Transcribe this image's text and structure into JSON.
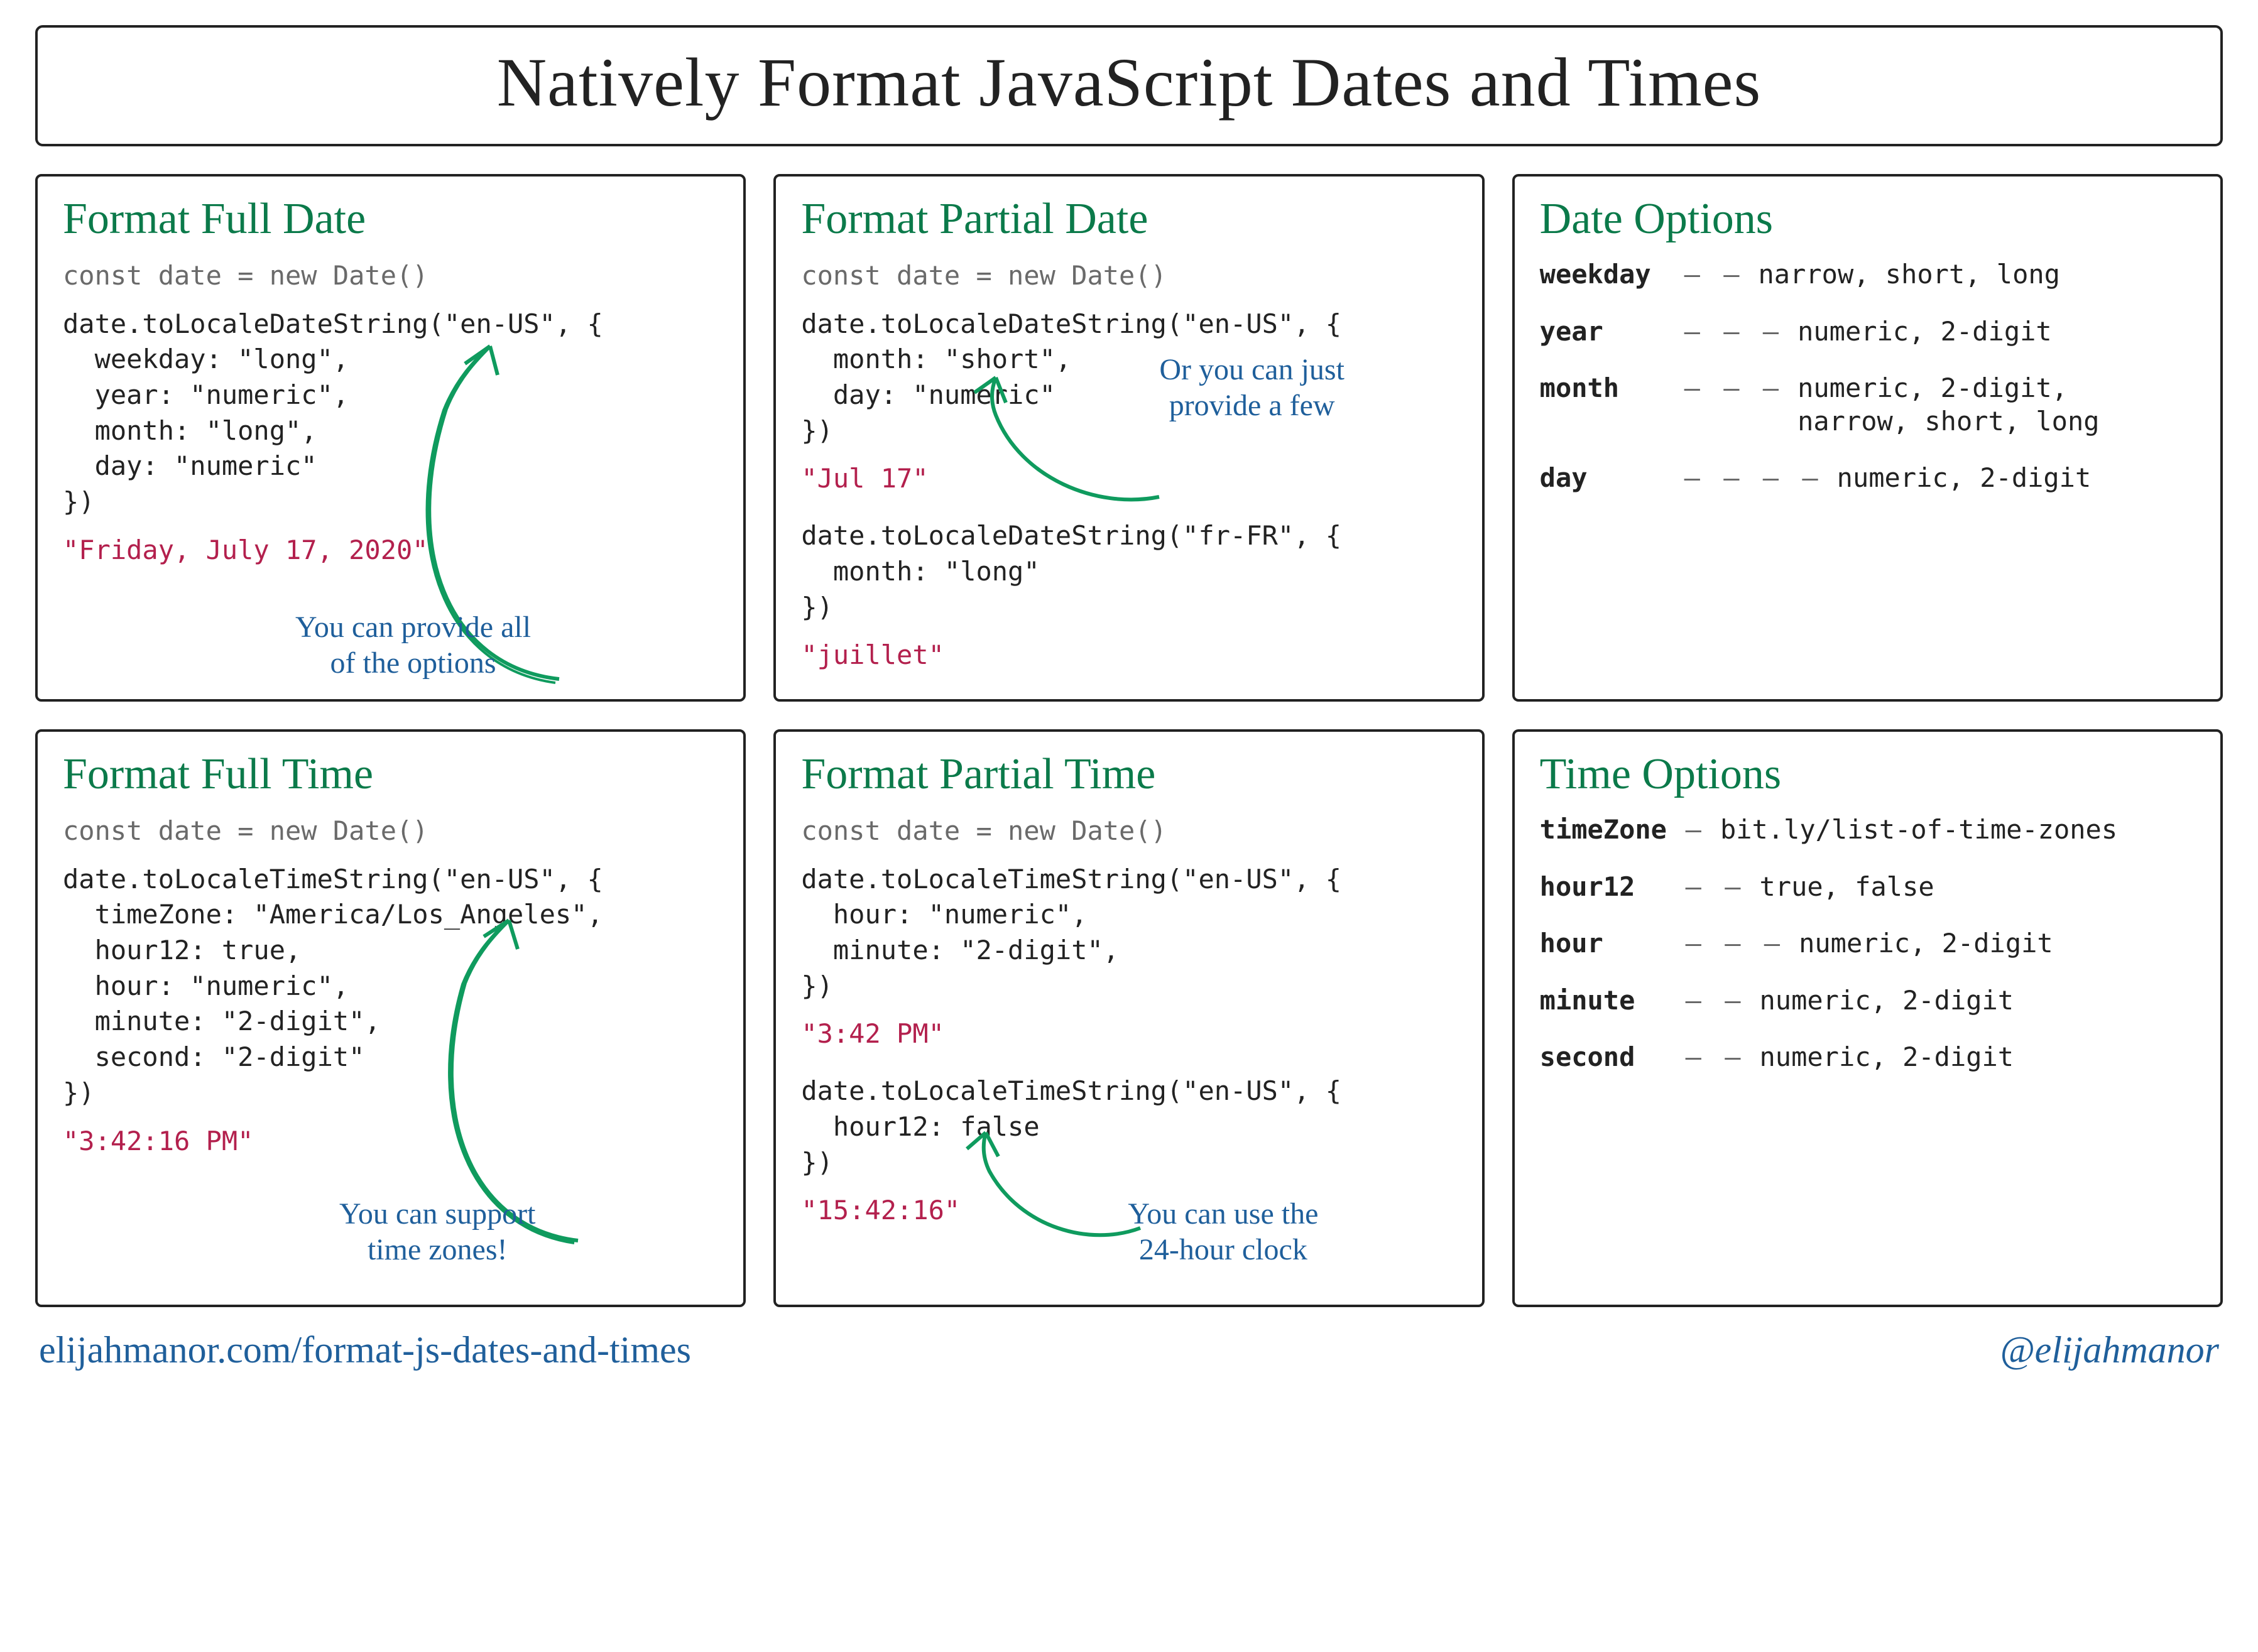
{
  "title": "Natively Format JavaScript Dates and Times",
  "panels": {
    "full_date": {
      "heading": "Format Full Date",
      "decl": "const date = new Date()",
      "code": "date.toLocaleDateString(\"en-US\", {\n  weekday: \"long\",\n  year: \"numeric\",\n  month: \"long\",\n  day: \"numeric\"\n})",
      "result": "\"Friday, July 17, 2020\"",
      "annot": "You can provide all\nof the options"
    },
    "partial_date": {
      "heading": "Format Partial Date",
      "decl": "const date = new Date()",
      "code1": "date.toLocaleDateString(\"en-US\", {\n  month: \"short\",\n  day: \"numeric\"\n})",
      "result1": "\"Jul 17\"",
      "code2": "date.toLocaleDateString(\"fr-FR\", {\n  month: \"long\"\n})",
      "result2": "\"juillet\"",
      "annot": "Or you can just\nprovide a few"
    },
    "date_options": {
      "heading": "Date Options",
      "rows": [
        {
          "key": "weekday",
          "dashes": "— —",
          "vals": "narrow, short, long"
        },
        {
          "key": "year",
          "dashes": "— — —",
          "vals": "numeric, 2-digit"
        },
        {
          "key": "month",
          "dashes": "— — —",
          "vals": "numeric, 2-digit,\nnarrow, short, long"
        },
        {
          "key": "day",
          "dashes": "— — — —",
          "vals": "numeric, 2-digit"
        }
      ]
    },
    "full_time": {
      "heading": "Format Full Time",
      "decl": "const date = new Date()",
      "code": "date.toLocaleTimeString(\"en-US\", {\n  timeZone: \"America/Los_Angeles\",\n  hour12: true,\n  hour: \"numeric\",\n  minute: \"2-digit\",\n  second: \"2-digit\"\n})",
      "result": "\"3:42:16 PM\"",
      "annot": "You can support\ntime zones!"
    },
    "partial_time": {
      "heading": "Format Partial Time",
      "decl": "const date = new Date()",
      "code1": "date.toLocaleTimeString(\"en-US\", {\n  hour: \"numeric\",\n  minute: \"2-digit\",\n})",
      "result1": "\"3:42 PM\"",
      "code2": "date.toLocaleTimeString(\"en-US\", {\n  hour12: false\n})",
      "result2": "\"15:42:16\"",
      "annot": "You can use the\n24-hour clock"
    },
    "time_options": {
      "heading": "Time Options",
      "rows": [
        {
          "key": "timeZone",
          "dashes": "—",
          "vals": "bit.ly/list-of-time-zones"
        },
        {
          "key": "hour12",
          "dashes": "— —",
          "vals": "true, false"
        },
        {
          "key": "hour",
          "dashes": "— — —",
          "vals": "numeric, 2-digit"
        },
        {
          "key": "minute",
          "dashes": "— —",
          "vals": "numeric, 2-digit"
        },
        {
          "key": "second",
          "dashes": "— —",
          "vals": "numeric, 2-digit"
        }
      ]
    }
  },
  "footer": {
    "left": "elijahmanor.com/format-js-dates-and-times",
    "right": "@elijahmanor"
  }
}
